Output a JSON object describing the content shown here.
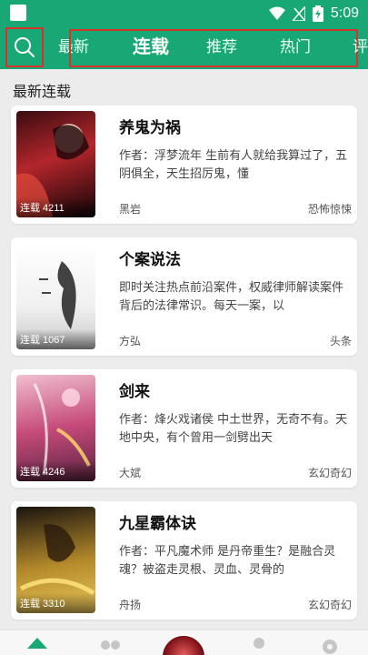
{
  "status": {
    "time": "5:09"
  },
  "header": {
    "tabs": [
      {
        "label": "最新",
        "active": false
      },
      {
        "label": "连载",
        "active": true
      },
      {
        "label": "推荐",
        "active": false
      },
      {
        "label": "热门",
        "active": false
      },
      {
        "label": "评",
        "active": false
      }
    ]
  },
  "section": {
    "title": "最新连载"
  },
  "books": [
    {
      "title": "养鬼为祸",
      "desc": "作者：浮梦流年 生前有人就给我算过了，五阴俱全，天生招厉鬼，懂",
      "author": "黑岩",
      "genre": "恐怖惊悚",
      "badge": "连载 4211",
      "cover_colors": [
        "#3a0c10",
        "#b3262b",
        "#120408"
      ]
    },
    {
      "title": "个案说法",
      "desc": "即时关注热点前沿案件，权威律师解读案件背后的法律常识。每天一案，以",
      "author": "方弘",
      "genre": "头条",
      "badge": "连载 1067",
      "cover_colors": [
        "#ffffff",
        "#e4e4e4",
        "#9a9a9a"
      ]
    },
    {
      "title": "剑来",
      "desc": "作者：烽火戏诸侯 中土世界，无奇不有。天地中央，有个曾用一剑劈出天",
      "author": "大斌",
      "genre": "玄幻奇幻",
      "badge": "连载 4246",
      "cover_colors": [
        "#f0bfd0",
        "#c64b7a",
        "#5a2340"
      ]
    },
    {
      "title": "九星霸体诀",
      "desc": "作者：平凡魔术师 是丹帝重生？是融合灵魂？被盗走灵根、灵血、灵骨的",
      "author": "舟扬",
      "genre": "玄幻奇幻",
      "badge": "连载 3310",
      "cover_colors": [
        "#1a1410",
        "#b58a2a",
        "#e8c65a"
      ]
    }
  ],
  "colors": {
    "accent": "#18a876",
    "highlight": "#d9312b"
  }
}
